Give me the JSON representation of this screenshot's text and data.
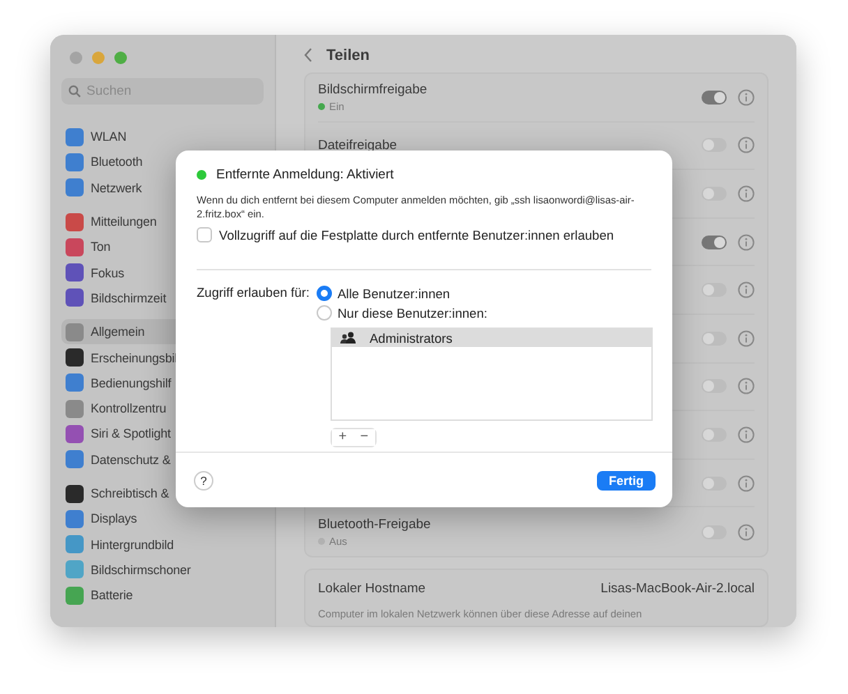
{
  "window": {
    "title": "Teilen",
    "search": {
      "placeholder": "Suchen"
    }
  },
  "sidebar": {
    "groups": [
      [
        {
          "label": "WLAN",
          "color": "#3f7fcf",
          "selected": false
        },
        {
          "label": "Bluetooth",
          "color": "#3f7fcf",
          "selected": false
        },
        {
          "label": "Netzwerk",
          "color": "#3f7fcf",
          "selected": false
        }
      ],
      [
        {
          "label": "Mitteilungen",
          "color": "#c94a48",
          "selected": false
        },
        {
          "label": "Ton",
          "color": "#c9475c",
          "selected": false
        },
        {
          "label": "Fokus",
          "color": "#5f52b8",
          "selected": false
        },
        {
          "label": "Bildschirmzeit",
          "color": "#5f52b8",
          "selected": false
        }
      ],
      [
        {
          "label": "Allgemein",
          "color": "#8a8a8a",
          "selected": true
        },
        {
          "label": "Erscheinungsbil",
          "color": "#2a2a2a",
          "selected": false
        },
        {
          "label": "Bedienungshilf",
          "color": "#3f7fcf",
          "selected": false
        },
        {
          "label": "Kontrollzentru",
          "color": "#8a8a8a",
          "selected": false
        },
        {
          "label": "Siri & Spotlight",
          "color": "#9450b2",
          "selected": false
        },
        {
          "label": "Datenschutz &",
          "color": "#3f7fcf",
          "selected": false
        }
      ],
      [
        {
          "label": "Schreibtisch &",
          "color": "#2a2a2a",
          "selected": false
        },
        {
          "label": "Displays",
          "color": "#3f7fcf",
          "selected": false
        },
        {
          "label": "Hintergrundbild",
          "color": "#4597c6",
          "selected": false
        },
        {
          "label": "Bildschirmschoner",
          "color": "#50a5c6",
          "selected": false
        },
        {
          "label": "Batterie",
          "color": "#46a552",
          "selected": false
        }
      ]
    ]
  },
  "services": [
    {
      "name": "Bildschirmfreigabe",
      "status": "Ein",
      "status_on": true,
      "on": true
    },
    {
      "name": "Dateifreigabe",
      "on": false
    },
    {
      "on": false
    },
    {
      "on": true
    },
    {
      "on": false
    },
    {
      "on": false
    },
    {
      "on": false
    },
    {
      "on": false
    },
    {
      "on": false
    },
    {
      "name": "Bluetooth-Freigabe",
      "status": "Aus",
      "status_on": false,
      "on": false
    }
  ],
  "hostname": {
    "label": "Lokaler Hostname",
    "value": "Lisas-MacBook-Air-2.local",
    "caption": "Computer im lokalen Netzwerk können über diese Adresse auf deinen"
  },
  "dialog": {
    "status": "Entfernte Anmeldung: Aktiviert",
    "status_on": true,
    "description": "Wenn du dich entfernt bei diesem Computer anmelden möchten, gib „ssh lisaonwordi@lisas-air-2.fritz.box“ ein.",
    "full_access": {
      "label": "Vollzugriff auf die Festplatte durch entfernte Benutzer:innen erlauben",
      "checked": false
    },
    "access_label": "Zugriff erlauben für:",
    "access_options": [
      {
        "label": "Alle Benutzer:innen",
        "selected": true
      },
      {
        "label": "Nur diese Benutzer:innen:",
        "selected": false
      }
    ],
    "users": [
      {
        "name": "Administrators",
        "selected": true
      }
    ],
    "add": "+",
    "remove": "−",
    "help": "?",
    "done": "Fertig"
  }
}
